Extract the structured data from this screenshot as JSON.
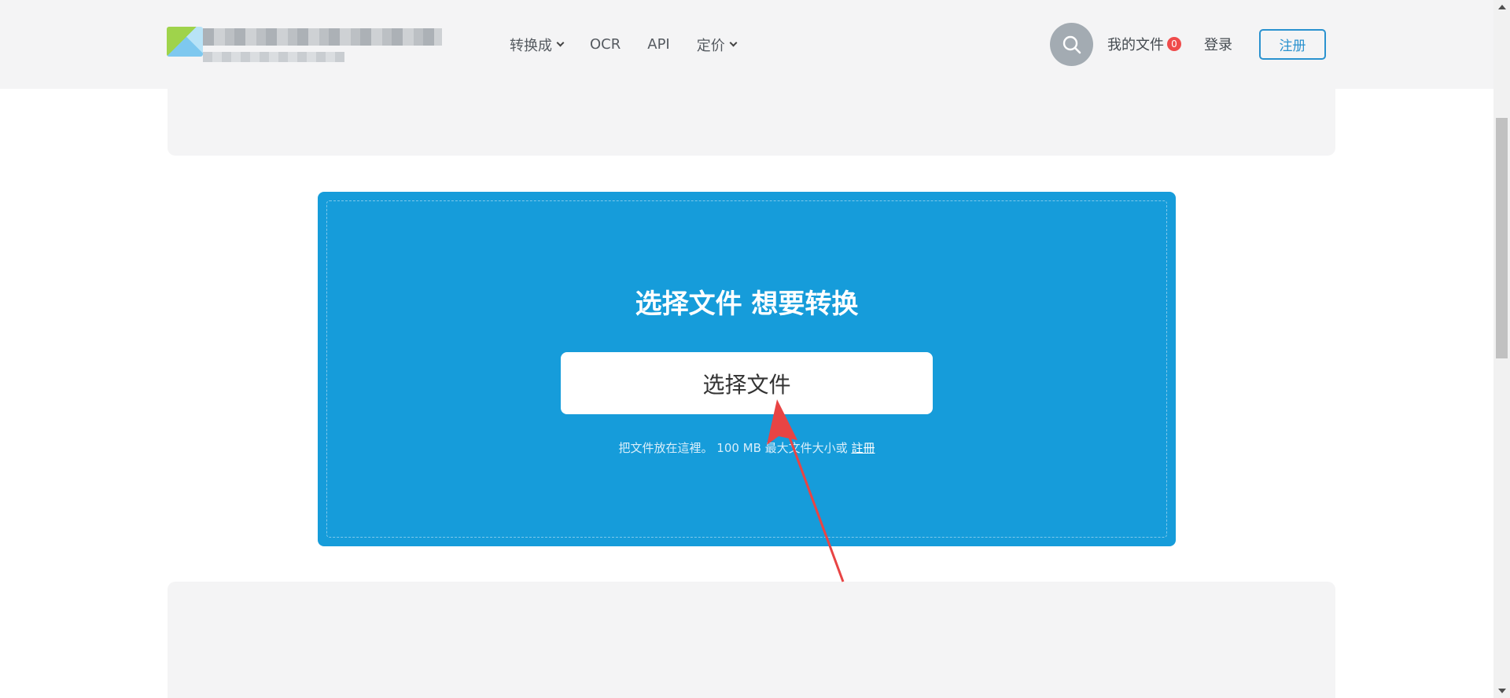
{
  "nav": {
    "items": [
      {
        "label": "转换成",
        "dropdown": true
      },
      {
        "label": "OCR",
        "dropdown": false
      },
      {
        "label": "API",
        "dropdown": false
      },
      {
        "label": "定价",
        "dropdown": true
      }
    ]
  },
  "header": {
    "search_icon": "search-icon",
    "my_files_label": "我的文件",
    "my_files_count": "0",
    "login_label": "登录",
    "register_label": "注册"
  },
  "upload": {
    "title": "选择文件 想要转换",
    "button_label": "选择文件",
    "hint_text": "把文件放在這裡。 100 MB 最大文件大小或 ",
    "hint_link": "註冊"
  },
  "colors": {
    "upload_bg": "#169cda",
    "register_border": "#2a92cf",
    "badge": "#ef4b4b",
    "arrow": "#e84444"
  }
}
